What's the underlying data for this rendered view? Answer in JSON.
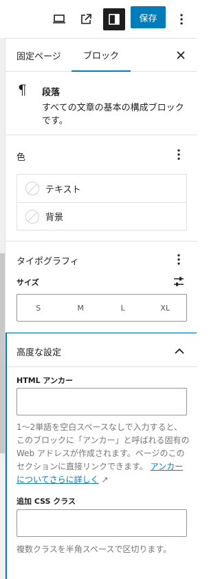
{
  "toolbar": {
    "preview_icon": "laptop-icon",
    "view_post_icon": "external-link-icon",
    "settings_icon": "sidebar-toggle-icon",
    "save_label": "保存",
    "more_icon": "more-vertical-icon",
    "accent": "#007cba"
  },
  "tabs": {
    "page_label": "固定ページ",
    "block_label": "ブロック",
    "close_icon": "close-icon"
  },
  "block": {
    "icon": "paragraph-icon",
    "glyph": "¶",
    "title": "段落",
    "description": "すべての文章の基本の構成ブロックです。"
  },
  "color": {
    "title": "色",
    "items": [
      {
        "label": "テキスト"
      },
      {
        "label": "背景"
      }
    ]
  },
  "typography": {
    "title": "タイポグラフィ",
    "size_label": "サイズ",
    "sizes": [
      "S",
      "M",
      "L",
      "XL"
    ]
  },
  "advanced": {
    "title": "高度な設定",
    "anchor_label": "HTML アンカー",
    "anchor_value": "",
    "anchor_help": "1〜2単語を空白スペースなしで入力すると、このブロックに「アンカー」と呼ばれる固有の Web アドレスが作成されます。ページのこのセクションに直接リンクできます。",
    "anchor_link": "アンカーについてさらに詳しく",
    "css_label": "追加 CSS クラス",
    "css_value": "",
    "css_help": "複数クラスを半角スペースで区切ります。"
  }
}
